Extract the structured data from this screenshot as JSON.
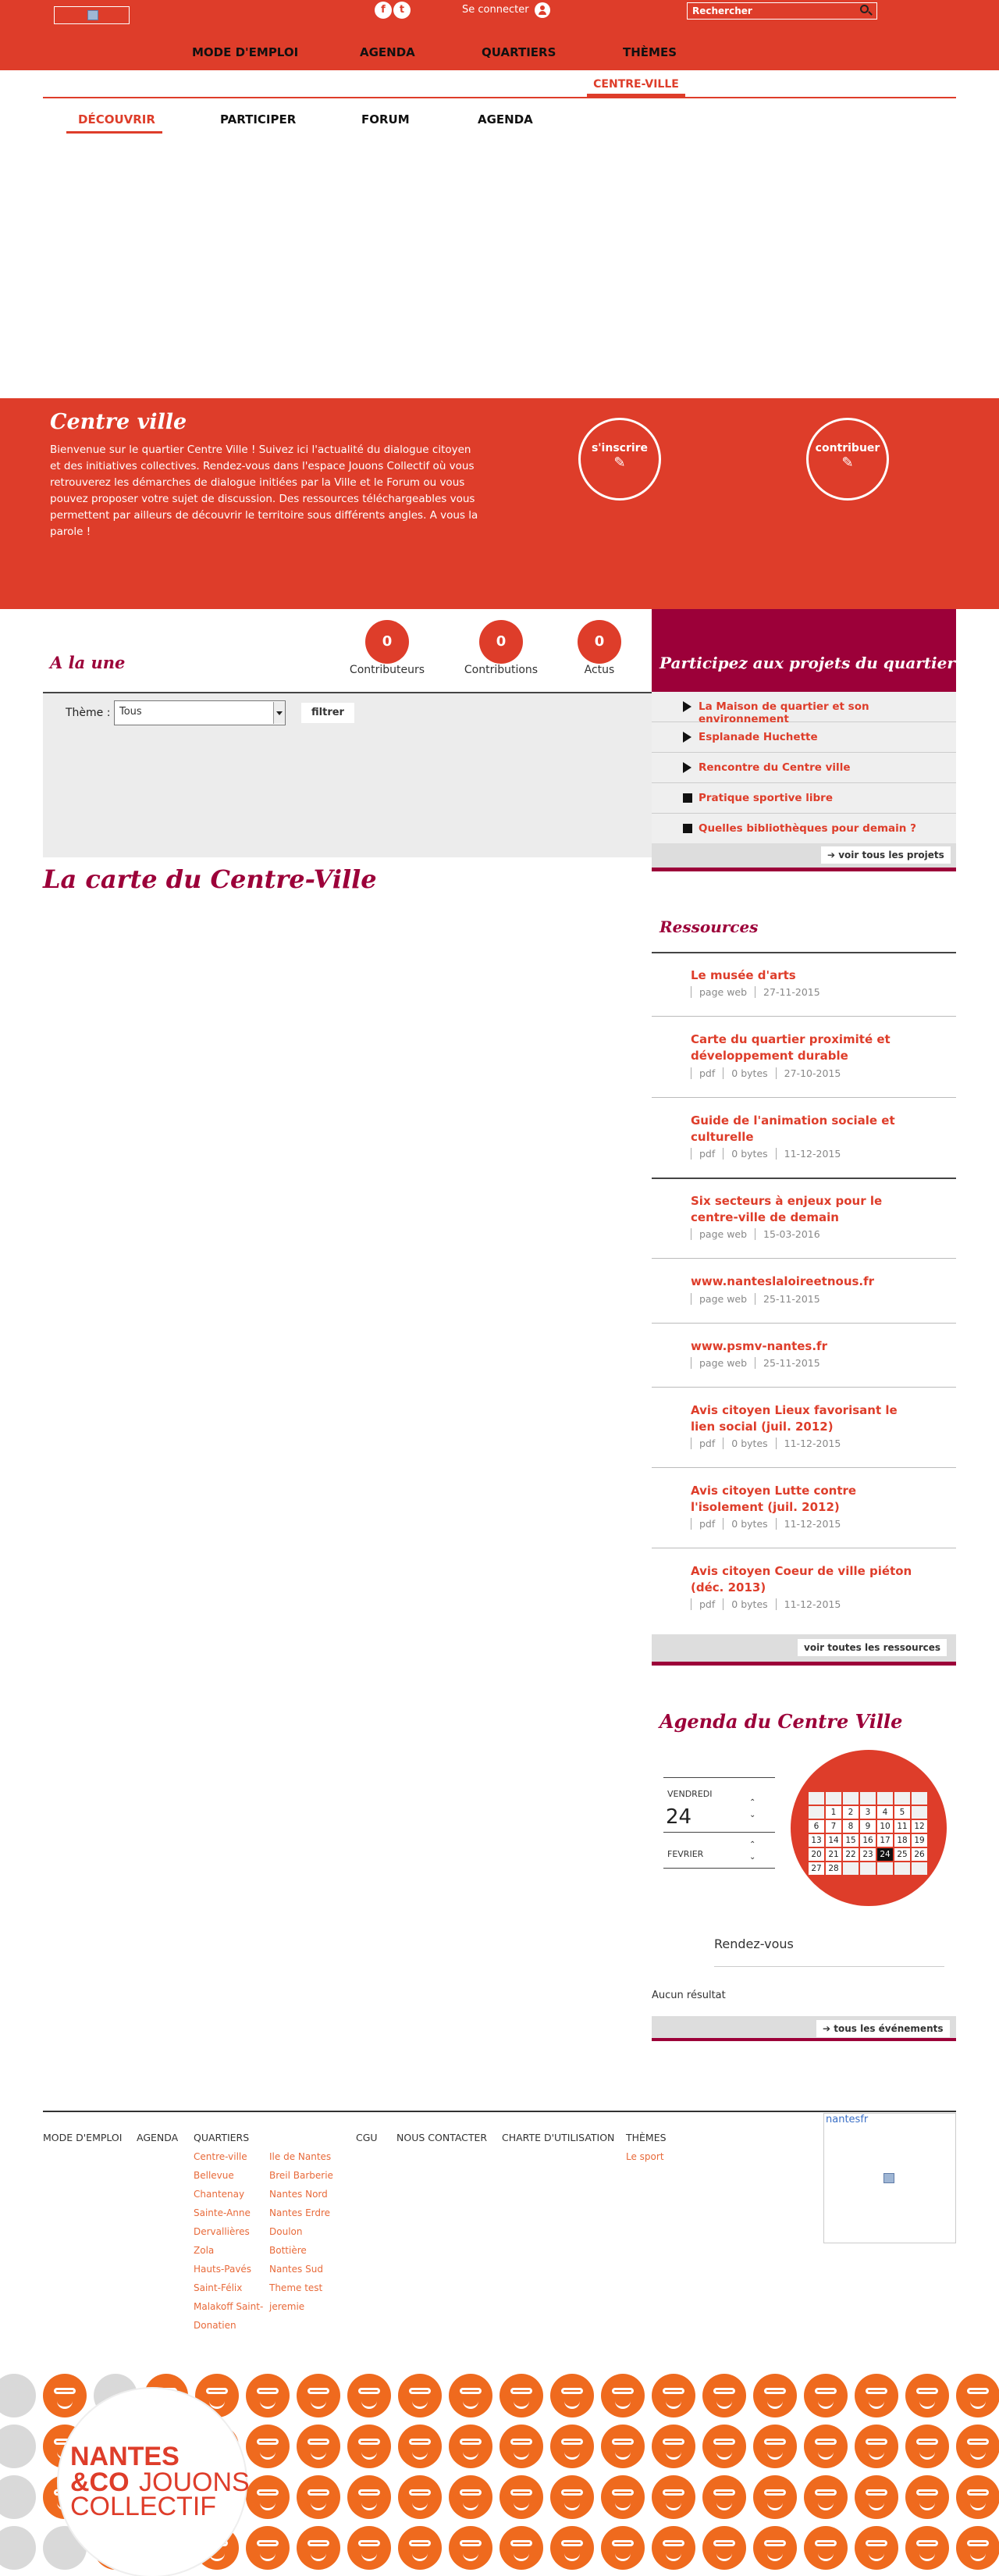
{
  "header": {
    "login_label": "Se connecter",
    "search_placeholder": "Rechercher",
    "social": {
      "facebook": "f",
      "twitter": "t"
    },
    "main_nav": [
      "MODE D'EMPLOI",
      "AGENDA",
      "QUARTIERS",
      "THÈMES"
    ]
  },
  "subnav": {
    "quartier": "CENTRE-VILLE",
    "tabs": [
      "DÉCOUVRIR",
      "PARTICIPER",
      "FORUM",
      "AGENDA"
    ]
  },
  "hero": {
    "title": "Centre ville",
    "text": "Bienvenue sur le quartier Centre Ville ! Suivez ici l'actualité du dialogue citoyen et des initiatives collectives. Rendez-vous dans l'espace Jouons Collectif où vous retrouverez les démarches de dialogue initiées par la Ville et le Forum ou vous pouvez proposer votre sujet de discussion. Des ressources téléchargeables vous permettent par ailleurs de découvrir le territoire sous différents angles. A vous la parole !",
    "inscrire": "s'inscrire",
    "contribuer": "contribuer",
    "pen_icon": "✎"
  },
  "alaune": {
    "title": "A la une",
    "stats": [
      {
        "value": "0",
        "label": "Contributeurs"
      },
      {
        "value": "0",
        "label": "Contributions"
      },
      {
        "value": "0",
        "label": "Actus"
      }
    ],
    "theme_label": "Thème :",
    "theme_value": "Tous",
    "filter_label": "filtrer"
  },
  "carte_title": "La carte du Centre-Ville",
  "projets": {
    "title": "Participez aux projets du quartier",
    "items": [
      {
        "label": "La Maison de quartier et son environnement",
        "icon": "triangle"
      },
      {
        "label": "Esplanade Huchette",
        "icon": "triangle"
      },
      {
        "label": "Rencontre du Centre ville",
        "icon": "triangle"
      },
      {
        "label": "Pratique sportive libre",
        "icon": "square"
      },
      {
        "label": "Quelles bibliothèques pour demain ?",
        "icon": "square"
      }
    ],
    "see_all": "voir tous les projets"
  },
  "ressources": {
    "title": "Ressources",
    "items": [
      {
        "title": "Le musée d'arts",
        "type": "page web",
        "size": "",
        "date": "27-11-2015"
      },
      {
        "title": "Carte du quartier proximité et développement durable",
        "type": "pdf",
        "size": "0 bytes",
        "date": "27-10-2015"
      },
      {
        "title": "Guide de l'animation sociale et culturelle",
        "type": "pdf",
        "size": "0 bytes",
        "date": "11-12-2015"
      },
      {
        "title": "Six secteurs à enjeux pour le centre-ville de demain",
        "type": "page web",
        "size": "",
        "date": "15-03-2016"
      },
      {
        "title": "www.nanteslaloireetnous.fr",
        "type": "page web",
        "size": "",
        "date": "25-11-2015"
      },
      {
        "title": "www.psmv-nantes.fr",
        "type": "page web",
        "size": "",
        "date": "25-11-2015"
      },
      {
        "title": "Avis citoyen Lieux favorisant le lien social (juil. 2012)",
        "type": "pdf",
        "size": "0 bytes",
        "date": "11-12-2015"
      },
      {
        "title": "Avis citoyen Lutte contre l'isolement (juil. 2012)",
        "type": "pdf",
        "size": "0 bytes",
        "date": "11-12-2015"
      },
      {
        "title": "Avis citoyen Coeur de ville piéton (déc. 2013)",
        "type": "pdf",
        "size": "0 bytes",
        "date": "11-12-2015"
      }
    ],
    "see_all": "voir toutes les ressources"
  },
  "agenda": {
    "title": "Agenda du Centre Ville",
    "day_name": "VENDREDI",
    "day_number": "24",
    "month": "FEVRIER",
    "calendar": [
      [
        "",
        "",
        "",
        "",
        "",
        "",
        ""
      ],
      [
        "",
        "1",
        "2",
        "3",
        "4",
        "5",
        ""
      ],
      [
        "6",
        "7",
        "8",
        "9",
        "10",
        "11",
        "12"
      ],
      [
        "13",
        "14",
        "15",
        "16",
        "17",
        "18",
        "19"
      ],
      [
        "20",
        "21",
        "22",
        "23",
        "24",
        "25",
        "26"
      ],
      [
        "27",
        "28",
        "",
        "",
        "",
        "",
        ""
      ]
    ],
    "selected": "24",
    "rdv_label": "Rendez-vous",
    "no_result": "Aucun résultat",
    "see_all": "tous les événements"
  },
  "footer": {
    "cols": [
      "MODE D'EMPLOI",
      "AGENDA",
      "QUARTIERS",
      "CGU",
      "NOUS CONTACTER",
      "CHARTE D'UTILISATION",
      "THÈMES"
    ],
    "quartiers_a": [
      "Centre-ville",
      "Bellevue",
      "Chantenay",
      "Sainte-Anne",
      "Dervallières",
      "Zola",
      "Hauts-Pavés",
      "Saint-Félix",
      "Malakoff Saint-",
      "Donatien"
    ],
    "quartiers_b": [
      "Ile de Nantes",
      "Breil Barberie",
      "Nantes Nord",
      "Nantes Erdre",
      "Doulon",
      "Bottière",
      "Nantes Sud",
      "Theme test",
      "jeremie"
    ],
    "themes": [
      "Le sport"
    ],
    "twitter_link": "nantesfr"
  },
  "brand": {
    "line1": "NANTES",
    "line2a": "&CO",
    "line2b": "JOUONS",
    "line3": "COLLECTIF"
  }
}
